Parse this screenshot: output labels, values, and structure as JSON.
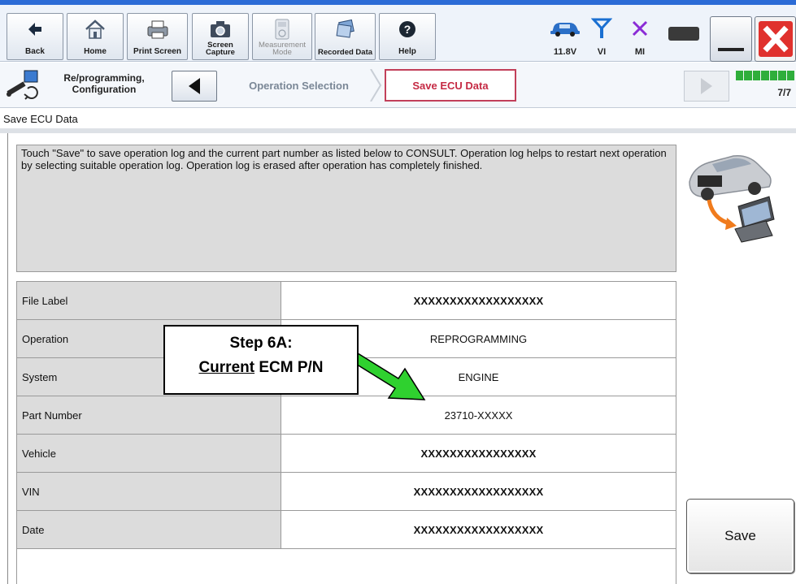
{
  "toolbar": {
    "back_label": "Back",
    "home_label": "Home",
    "print_screen_label": "Print Screen",
    "screen_capture_label": "Screen Capture",
    "measurement_mode_label": "Measurement Mode",
    "recorded_data_label": "Recorded Data",
    "help_label": "Help",
    "battery_voltage": "11.8V",
    "vi_label": "VI",
    "mi_label": "MI",
    "icons": {
      "back": "back-arrow-icon",
      "home": "home-icon",
      "print_screen": "printer-icon",
      "screen_capture": "camera-icon",
      "measurement_mode": "meter-icon",
      "recorded_data": "recorded-data-icon",
      "help": "help-icon",
      "vehicle": "car-icon",
      "vi": "antenna-icon",
      "mi": "x-mark-icon",
      "battery": "battery-icon",
      "minimize": "minimize-icon",
      "close": "close-icon"
    }
  },
  "nav": {
    "section_label_line1": "Re/programming,",
    "section_label_line2": "Configuration",
    "step_operation_selection": "Operation Selection",
    "step_save_ecu_data": "Save ECU Data",
    "page_count": "7/7",
    "progress": {
      "current": 7,
      "total": 7
    }
  },
  "page": {
    "title": "Save ECU Data",
    "instructions": "Touch \"Save\" to save operation log and the current part number as listed below to CONSULT. Operation log helps to restart next operation by selecting suitable operation log. Operation log is erased after operation has completely finished."
  },
  "table": {
    "rows": [
      {
        "label": "File Label",
        "value": "XXXXXXXXXXXXXXXXXX"
      },
      {
        "label": "Operation",
        "value": "REPROGRAMMING"
      },
      {
        "label": "System",
        "value": "ENGINE"
      },
      {
        "label": "Part Number",
        "value": "23710-XXXXX"
      },
      {
        "label": "Vehicle",
        "value": "XXXXXXXXXXXXXXXX"
      },
      {
        "label": "VIN",
        "value": "XXXXXXXXXXXXXXXXXX"
      },
      {
        "label": "Date",
        "value": "XXXXXXXXXXXXXXXXXX"
      }
    ]
  },
  "save_label": "Save",
  "callout": {
    "line1": "Step 6A:",
    "line2_underlined": "Current",
    "line2_rest": " ECM P/N"
  },
  "colors": {
    "accent_active_step": "#c52a44",
    "progress_green": "#2fae3b",
    "callout_arrow": "#2fd12f",
    "close_red": "#e0312d",
    "title_blue": "#2b6bd6"
  }
}
